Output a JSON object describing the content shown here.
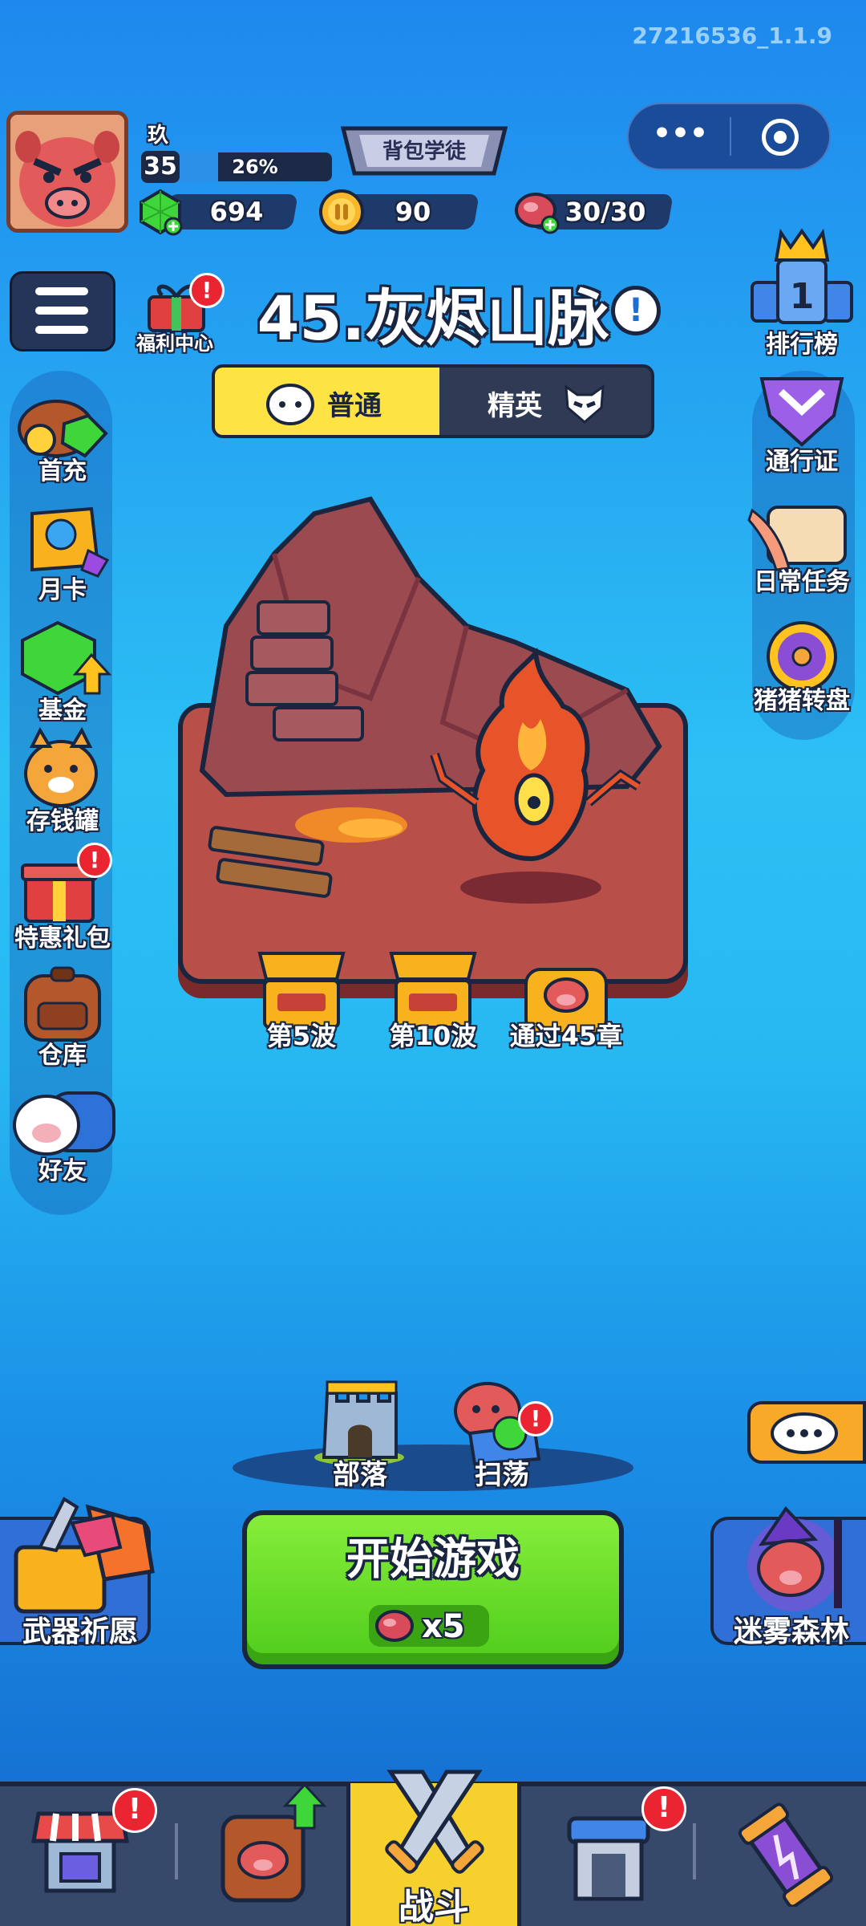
{
  "version": "27216536_1.1.9",
  "player": {
    "name": "玖",
    "level": "35",
    "xp_percent_label": "26%",
    "xp_fraction": 0.26,
    "rank_title": "背包学徒"
  },
  "resources": {
    "gems": "694",
    "coins": "90",
    "stamina": "30/30"
  },
  "left_menu": {
    "items": [
      {
        "label": "首充",
        "badge": false
      },
      {
        "label": "月卡",
        "badge": false
      },
      {
        "label": "基金",
        "badge": false
      },
      {
        "label": "存钱罐",
        "badge": false
      },
      {
        "label": "特惠礼包",
        "badge": true
      },
      {
        "label": "仓库",
        "badge": false
      },
      {
        "label": "好友",
        "badge": false
      }
    ]
  },
  "welfare": {
    "label": "福利中心"
  },
  "right_menu": {
    "items": [
      {
        "label": "排行榜"
      },
      {
        "label": "通行证"
      },
      {
        "label": "日常任务"
      },
      {
        "label": "猪猪转盘"
      }
    ]
  },
  "stage": {
    "title": "45.灰烬山脉",
    "info_symbol": "!"
  },
  "difficulty_tabs": {
    "normal": "普通",
    "elite": "精英"
  },
  "rewards": [
    {
      "label": "第5波"
    },
    {
      "label": "第10波"
    },
    {
      "label": "通过45章"
    }
  ],
  "mid_buttons": {
    "tribe": "部落",
    "sweep": "扫荡"
  },
  "start": {
    "label": "开始游戏",
    "cost": "x5"
  },
  "side_buttons": {
    "left": "武器祈愿",
    "right": "迷雾森林"
  },
  "bottom_nav": {
    "battle": "战斗"
  },
  "badge_symbol": "!",
  "colors": {
    "accent_yellow": "#fde344",
    "start_green": "#5ad426",
    "badge_red": "#ea2431",
    "nav_bg": "#37496b"
  }
}
